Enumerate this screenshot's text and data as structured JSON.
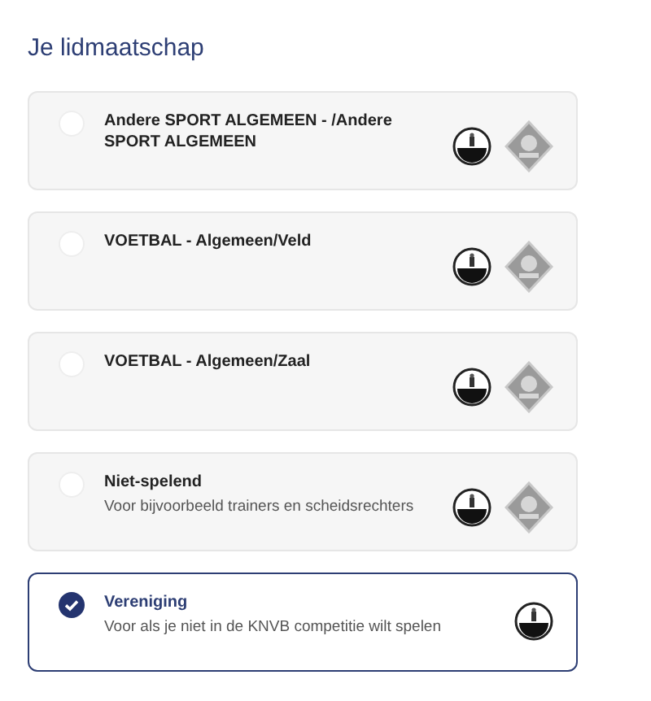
{
  "heading": "Je lidmaatschap",
  "options": [
    {
      "title": "Andere SPORT ALGEMEEN - /Andere SPORT ALGEMEEN",
      "selected": false,
      "club_crest": true,
      "federation_crest": true
    },
    {
      "title": "VOETBAL - Algemeen/Veld",
      "selected": false,
      "club_crest": true,
      "federation_crest": true
    },
    {
      "title": "VOETBAL - Algemeen/Zaal",
      "selected": false,
      "club_crest": true,
      "federation_crest": true
    },
    {
      "title": "Niet-spelend",
      "description": "Voor bijvoorbeeld trainers en scheidsrechters",
      "selected": false,
      "club_crest": true,
      "federation_crest": true
    },
    {
      "title": "Vereniging",
      "description": "Voor als je niet in de KNVB competitie wilt spelen",
      "selected": true,
      "club_crest": true,
      "federation_crest": false
    }
  ]
}
